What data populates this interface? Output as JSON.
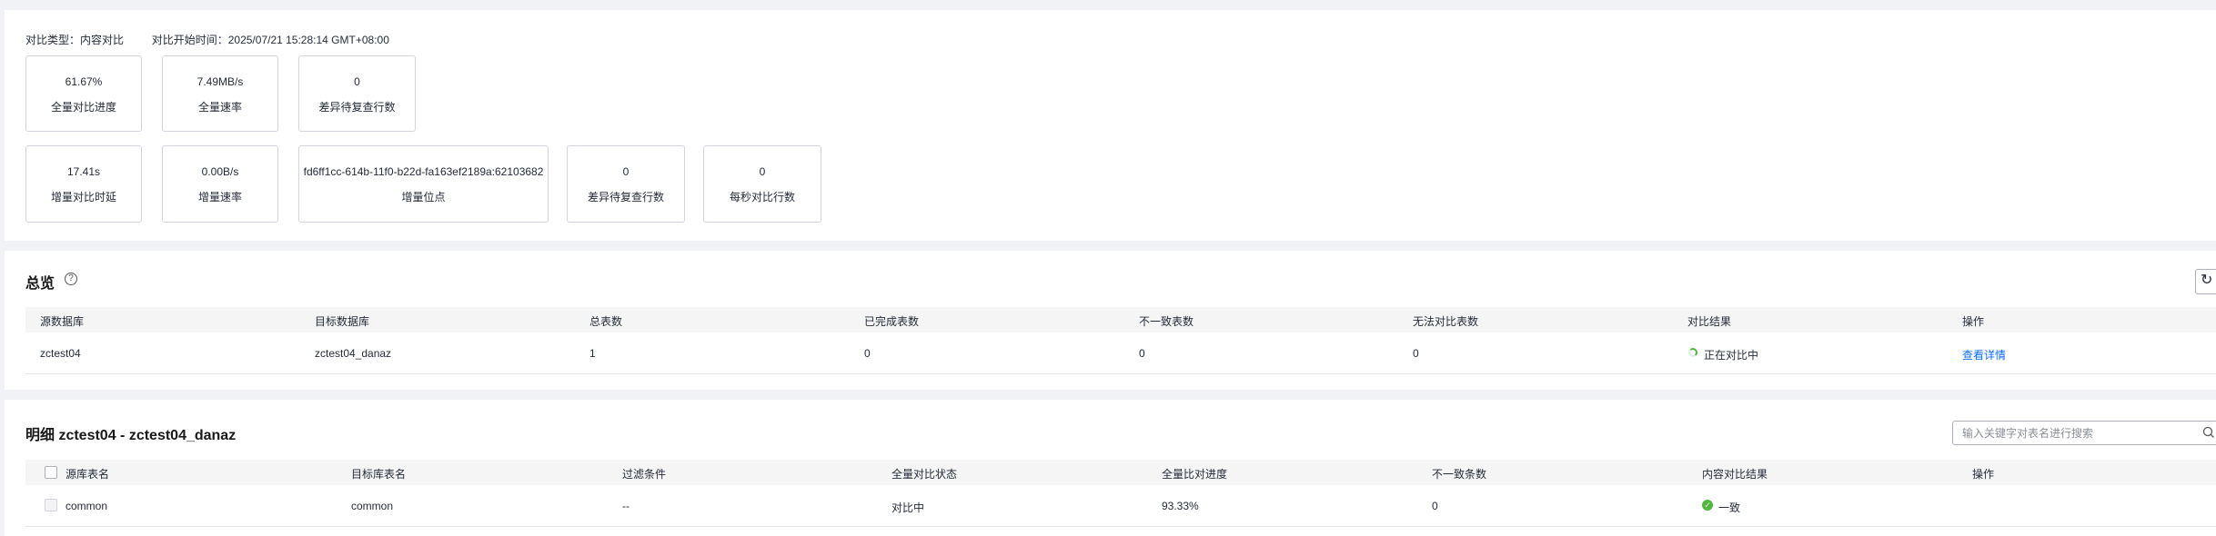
{
  "summary": {
    "compare_type_label": "对比类型：",
    "compare_type_value": "内容对比",
    "start_time_label": "对比开始时间：",
    "start_time_value": "2025/07/21 15:28:14 GMT+08:00"
  },
  "metrics_row1": [
    {
      "value": "61.67%",
      "label": "全量对比进度"
    },
    {
      "value": "7.49MB/s",
      "label": "全量速率"
    },
    {
      "value": "0",
      "label": "差异待复查行数"
    }
  ],
  "metrics_row2": [
    {
      "value": "17.41s",
      "label": "增量对比时延"
    },
    {
      "value": "0.00B/s",
      "label": "增量速率"
    },
    {
      "value": "fd6ff1cc-614b-11f0-b22d-fa163ef2189a:62103682",
      "label": "增量位点"
    },
    {
      "value": "0",
      "label": "差异待复查行数"
    },
    {
      "value": "0",
      "label": "每秒对比行数"
    }
  ],
  "overview": {
    "title": "总览",
    "help_icon": "?",
    "refresh_icon": "refresh-icon",
    "columns": [
      "源数据库",
      "目标数据库",
      "总表数",
      "已完成表数",
      "不一致表数",
      "无法对比表数",
      "对比结果",
      "操作"
    ],
    "rows": [
      {
        "source_db": "zctest04",
        "target_db": "zctest04_danaz",
        "total_tables": "1",
        "completed_tables": "0",
        "inconsistent_tables": "0",
        "uncomparable_tables": "0",
        "result": "正在对比中",
        "action": "查看详情"
      }
    ]
  },
  "detail": {
    "title": "明细 zctest04 - zctest04_danaz",
    "search_placeholder": "输入关键字对表名进行搜索",
    "columns": [
      "源库表名",
      "目标库表名",
      "过滤条件",
      "全量对比状态",
      "全量比对进度",
      "不一致条数",
      "内容对比结果",
      "操作"
    ],
    "rows": [
      {
        "source_table": "common",
        "target_table": "common",
        "filter": "--",
        "full_status": "对比中",
        "full_progress": "93.33%",
        "inconsistent_count": "0",
        "content_result": "一致",
        "action": ""
      }
    ]
  },
  "colors": {
    "link": "#0b6cff",
    "success": "#50b83c",
    "header_bg": "#f5f5f6"
  }
}
